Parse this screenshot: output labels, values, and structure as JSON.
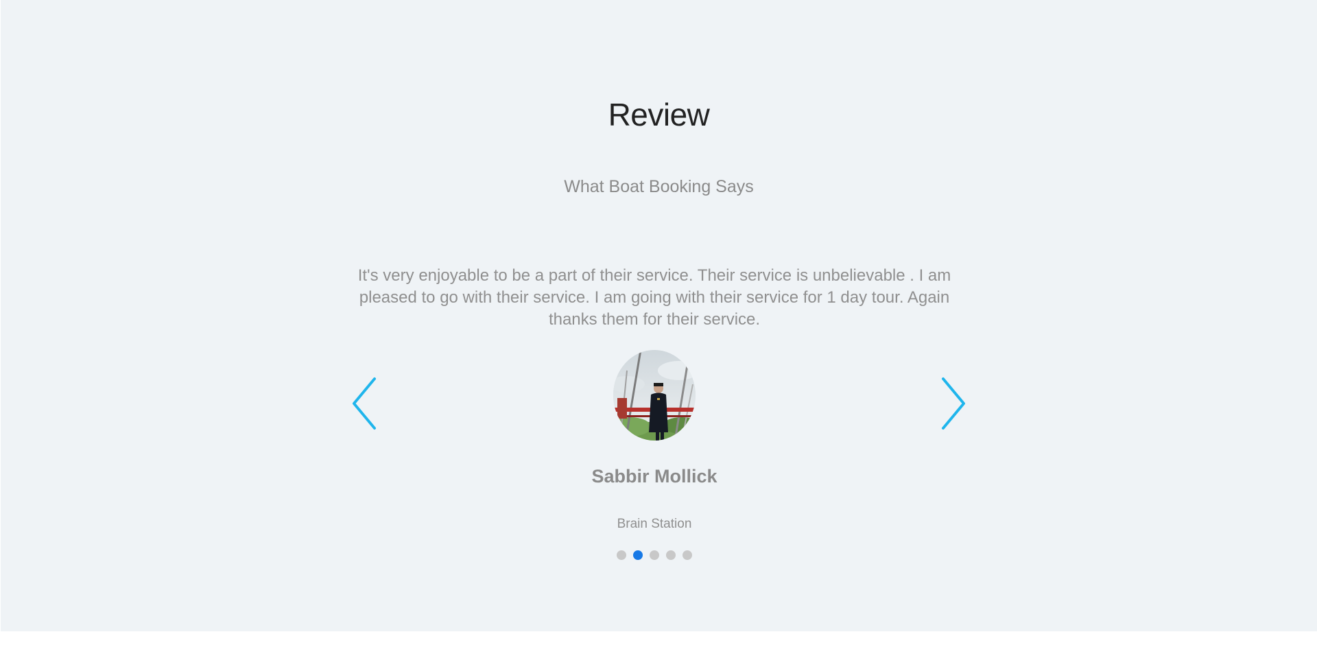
{
  "section": {
    "title": "Review",
    "subtitle": "What Boat Booking Says"
  },
  "testimonial": {
    "text": "It's very enjoyable to be a part of their service. Their service is unbelievable . I am pleased to go with their service. I am going with their service for 1 day tour. Again thanks them for their service.",
    "name": "Sabbir Mollick",
    "company": "Brain Station",
    "avatar_icon": "person-on-boat-photo"
  },
  "carousel": {
    "prev_icon": "chevron-left-icon",
    "next_icon": "chevron-right-icon",
    "slide_count": 5,
    "active_index": 1
  },
  "colors": {
    "background": "#eff3f6",
    "accent_arrow": "#1fb5ec",
    "active_dot": "#1779e6",
    "inactive_dot": "#c8c8c8"
  }
}
